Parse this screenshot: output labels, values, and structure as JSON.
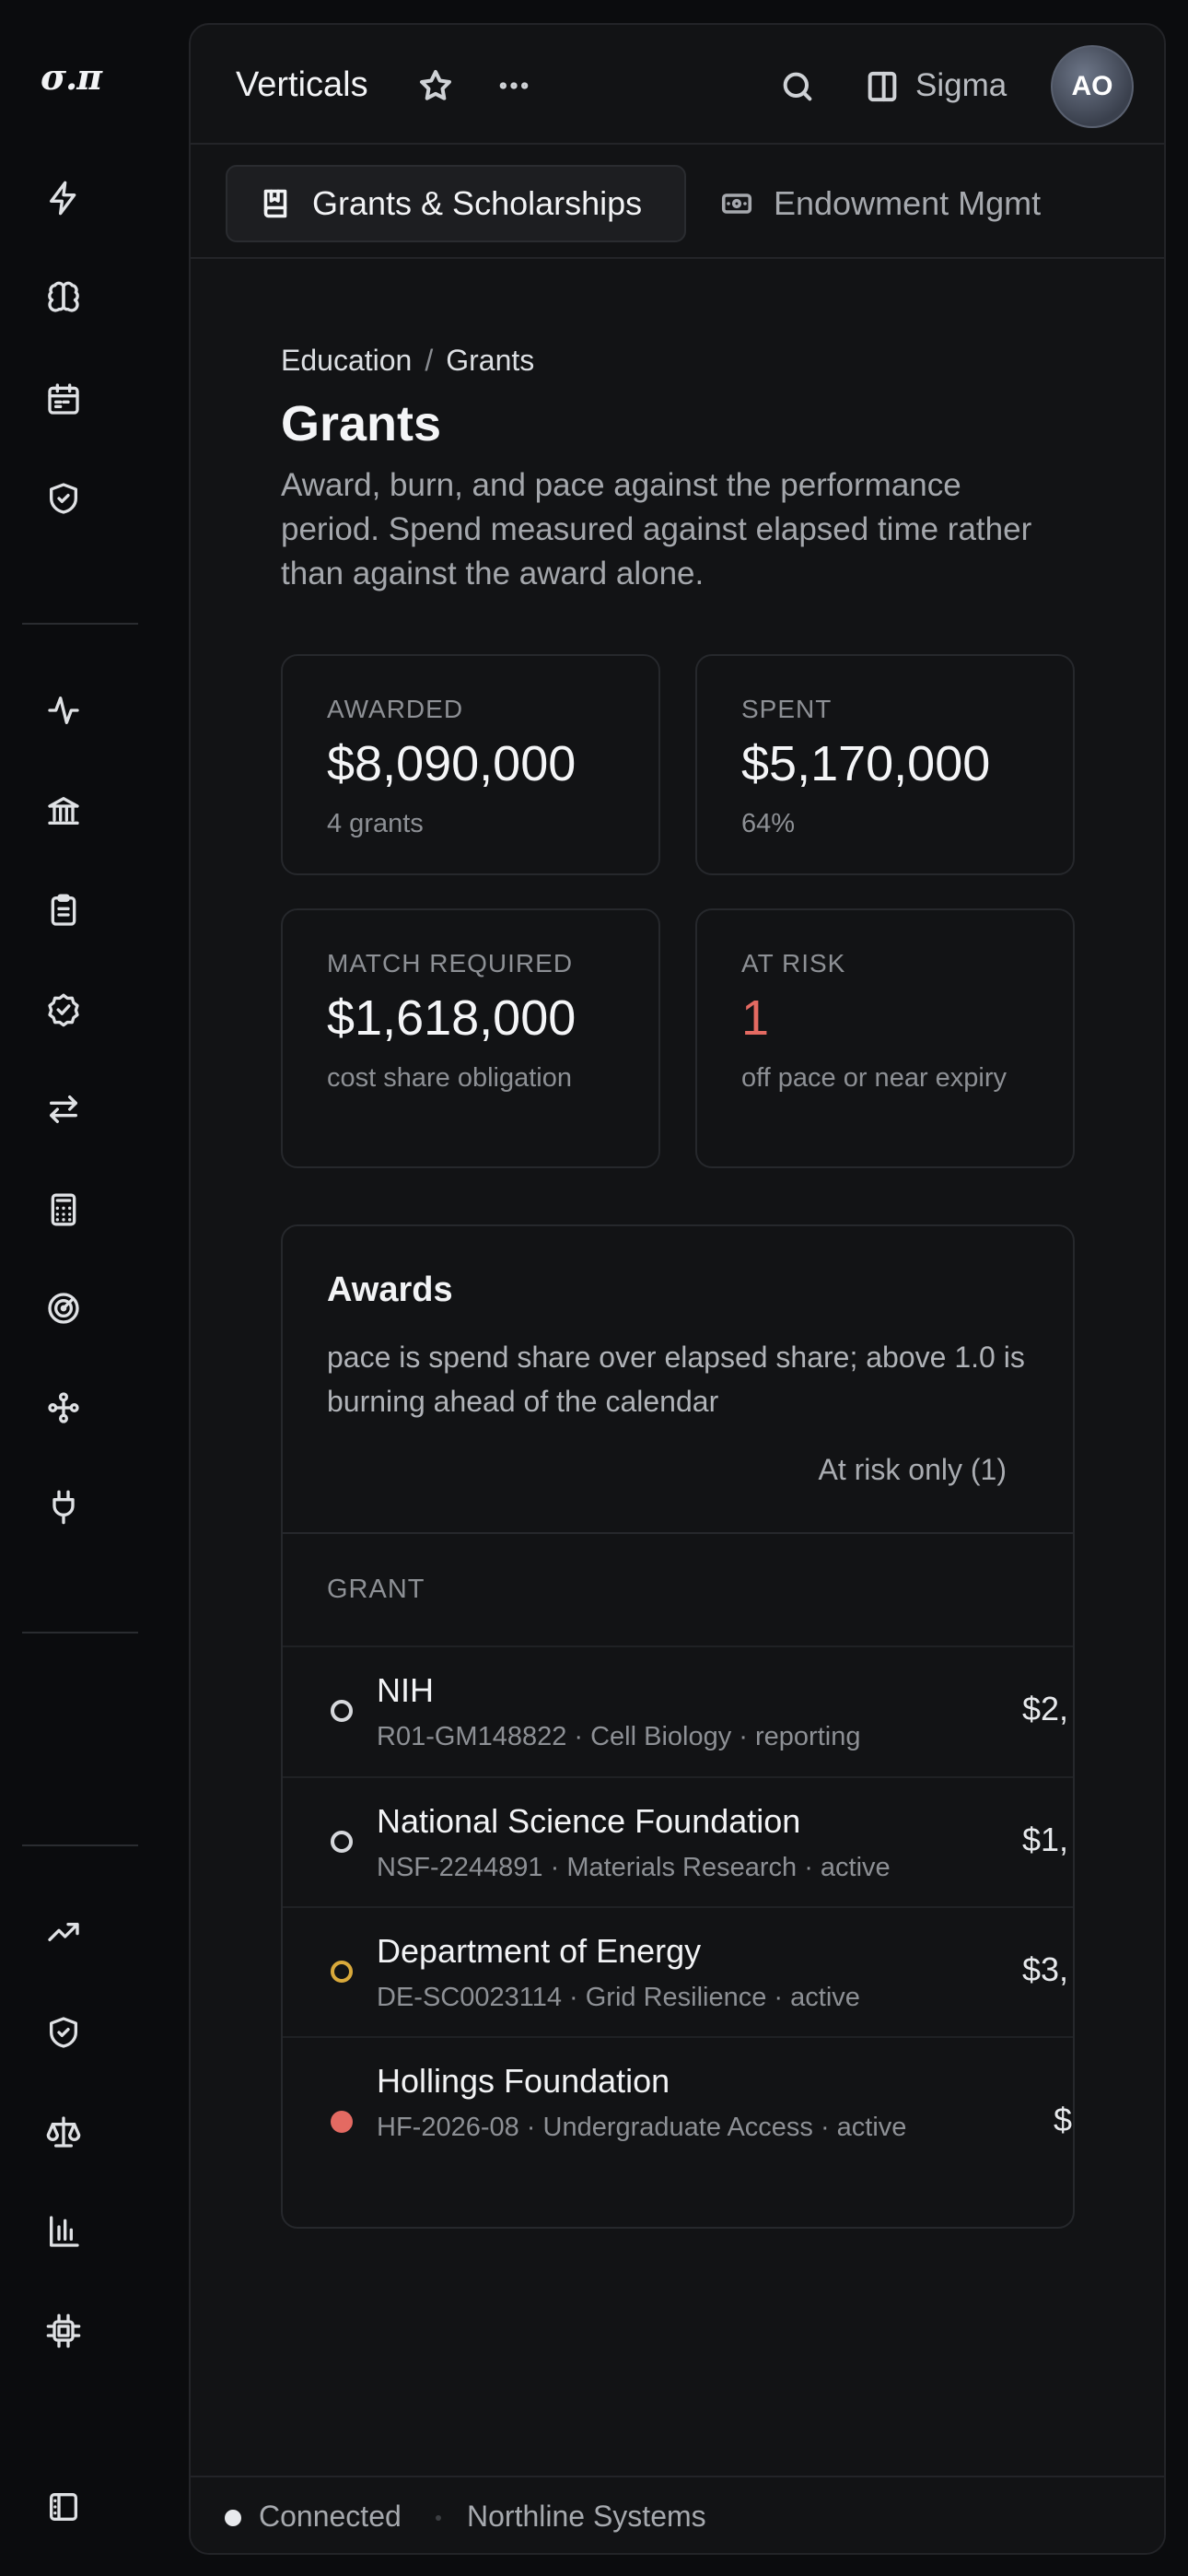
{
  "rail": {
    "logo": "σ.π",
    "groups": [
      [
        "bolt-icon",
        "brain-icon",
        "calendar-icon",
        "shield-check-icon"
      ],
      [
        "activity-icon",
        "bank-icon",
        "clipboard-icon",
        "badge-check-icon",
        "arrows-swap-icon",
        "calculator-icon",
        "radar-icon",
        "workflow-icon",
        "plug-icon"
      ],
      [
        "trending-up-icon",
        "shield-check-icon",
        "scale-icon",
        "bar-chart-icon",
        "chip-icon"
      ],
      [
        "sidebar-icon"
      ]
    ]
  },
  "topbar": {
    "title": "Verticals",
    "workspace": "Sigma",
    "avatar": "AO"
  },
  "tabs": [
    {
      "label": "Grants & Scholarships",
      "icon": "book-icon",
      "active": true
    },
    {
      "label": "Endowment Mgmt",
      "icon": "banknote-icon",
      "active": false
    }
  ],
  "breadcrumb": {
    "parent": "Education",
    "separator": "/",
    "current": "Grants"
  },
  "page": {
    "title": "Grants",
    "subtitle": "Award, burn, and pace against the performance period. Spend measured against elapsed time rather than against the award alone."
  },
  "stats": [
    {
      "label": "AWARDED",
      "value": "$8,090,000",
      "note": "4 grants",
      "tone": "normal"
    },
    {
      "label": "SPENT",
      "value": "$5,170,000",
      "note": "64%",
      "tone": "normal"
    },
    {
      "label": "MATCH REQUIRED",
      "value": "$1,618,000",
      "note": "cost share obligation",
      "tone": "normal"
    },
    {
      "label": "AT RISK",
      "value": "1",
      "note": "off pace or near expiry",
      "tone": "risk"
    }
  ],
  "awards": {
    "title": "Awards",
    "description": "pace is spend share over elapsed share; above 1.0 is burning ahead of the calendar",
    "filter": "At risk only (1)",
    "column_header": "GRANT",
    "rows": [
      {
        "name": "NIH",
        "meta": "R01-GM148822 · Cell Biology · reporting",
        "amount": "$2,",
        "status": "neutral"
      },
      {
        "name": "National Science Foundation",
        "meta": "NSF-2244891 · Materials Research · active",
        "amount": "$1,",
        "status": "neutral"
      },
      {
        "name": "Department of Energy",
        "meta": "DE-SC0023114 · Grid Resilience · active",
        "amount": "$3,",
        "status": "warning"
      },
      {
        "name": "Hollings Foundation",
        "meta": "HF-2026-08 · Undergraduate Access · active",
        "amount": "$",
        "status": "at-risk"
      }
    ]
  },
  "statusbar": {
    "connection": "Connected",
    "org": "Northline Systems"
  },
  "colors": {
    "background": "#0b0c0e",
    "panel": "#121315",
    "risk": "#e46a62",
    "warning": "#d9a93b"
  }
}
